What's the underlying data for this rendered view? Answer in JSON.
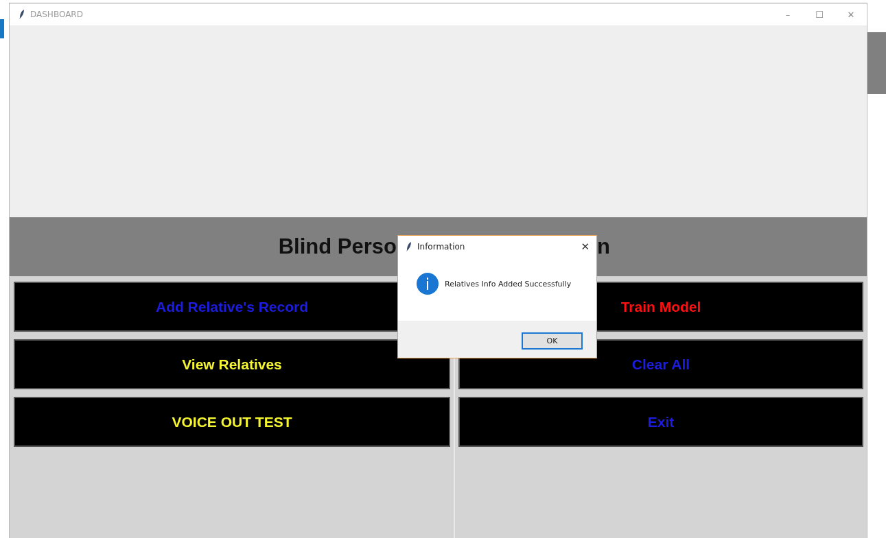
{
  "window": {
    "title": "DASHBOARD",
    "controls": [
      "–",
      "☐",
      "✕"
    ]
  },
  "heading": {
    "visible_parts": [
      "Blind Perso",
      "n"
    ]
  },
  "buttons": [
    {
      "label": "Add Relative's Record",
      "color": "#1c1ce0"
    },
    {
      "label": "Train Model",
      "color": "#ff1010"
    },
    {
      "label": "View Relatives",
      "color": "#f5f530"
    },
    {
      "label": "Clear All",
      "color": "#1c1ce0"
    },
    {
      "label": "VOICE OUT TEST",
      "color": "#f5f530"
    },
    {
      "label": "Exit",
      "color": "#1c1ce0"
    }
  ],
  "dialog": {
    "title": "Information",
    "close": "✕",
    "message": "Relatives Info Added Successfully",
    "button": "OK"
  }
}
